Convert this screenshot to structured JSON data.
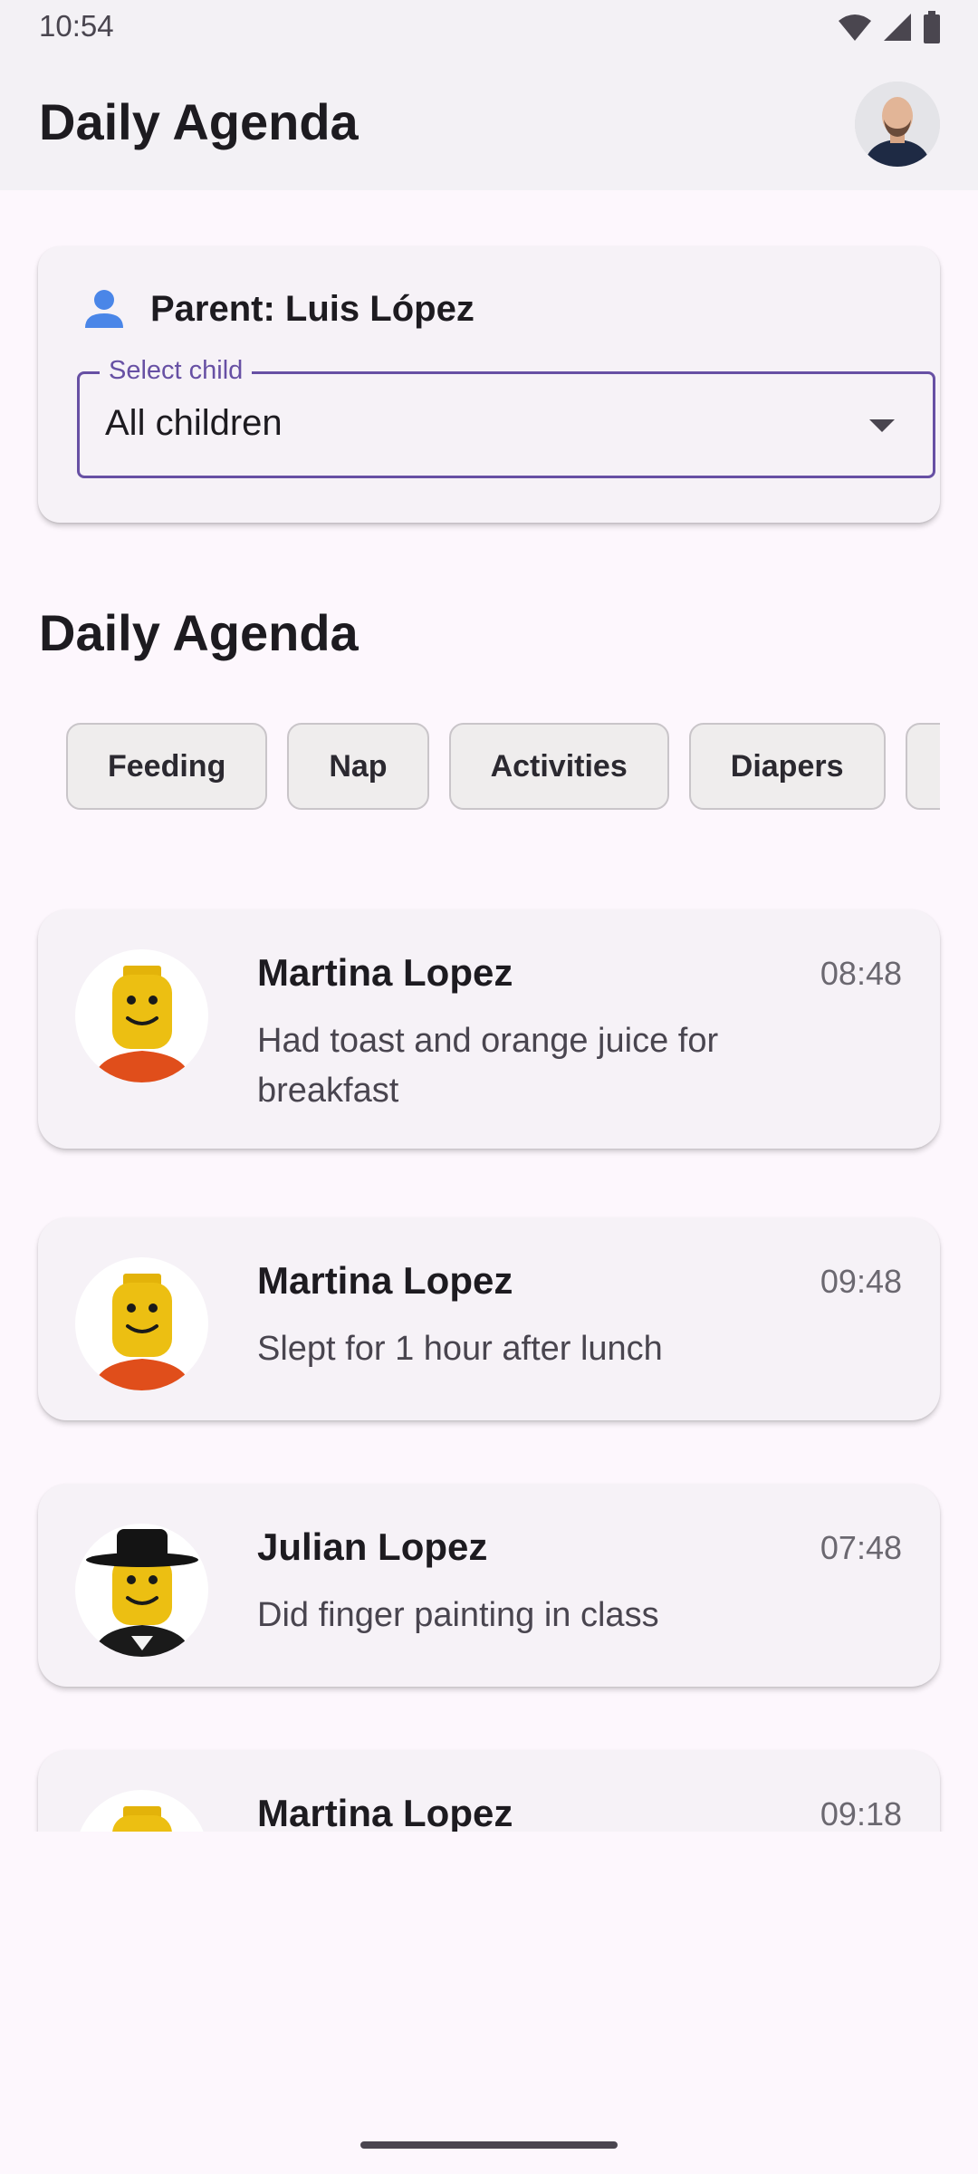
{
  "status_bar": {
    "time": "10:54"
  },
  "app_bar": {
    "title": "Daily Agenda"
  },
  "parent_card": {
    "parent_label": "Parent: Luis López",
    "select_caption": "Select child",
    "select_value": "All children"
  },
  "agenda": {
    "title": "Daily Agenda",
    "chips": [
      "Feeding",
      "Nap",
      "Activities",
      "Diapers"
    ]
  },
  "entries": [
    {
      "name": "Martina Lopez",
      "time": "08:48",
      "text": "Had toast and orange juice for breakfast",
      "avatar": "lego-yellow-figure"
    },
    {
      "name": "Martina Lopez",
      "time": "09:48",
      "text": "Slept for 1 hour after lunch",
      "avatar": "lego-yellow-figure"
    },
    {
      "name": "Julian Lopez",
      "time": "07:48",
      "text": "Did finger painting in class",
      "avatar": "lego-figure-black-hat"
    },
    {
      "name": "Martina Lopez",
      "time": "09:18",
      "text": "",
      "avatar": "lego-yellow-figure"
    }
  ],
  "colors": {
    "accent": "#6750a4",
    "person_icon": "#4a86e8"
  }
}
